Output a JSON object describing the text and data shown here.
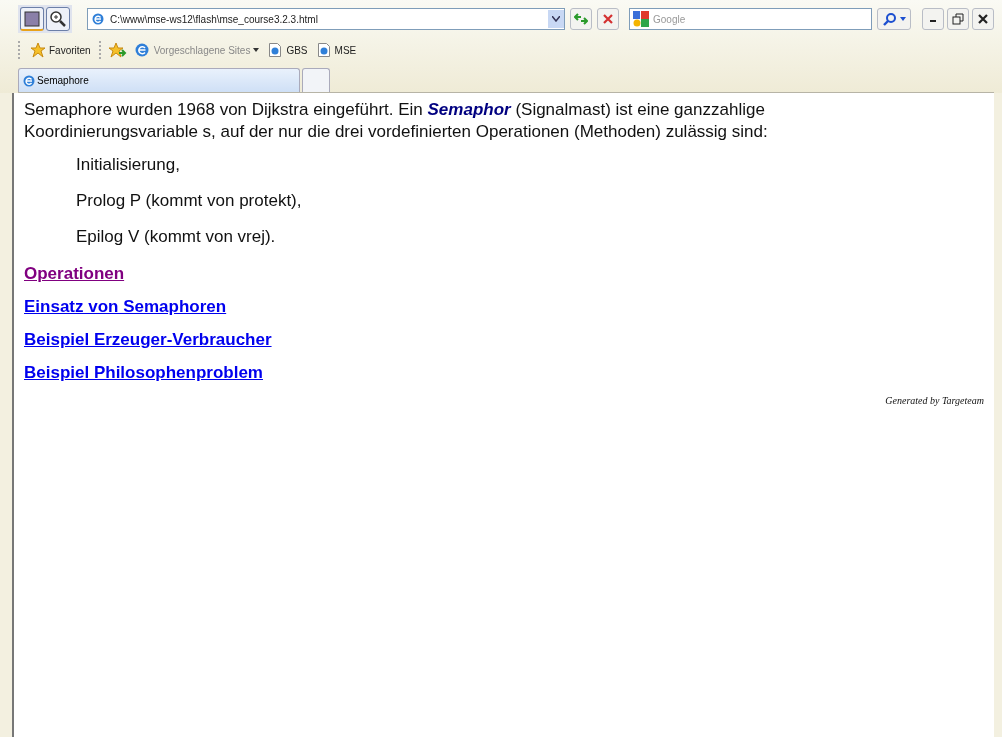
{
  "address_bar": {
    "url": "C:\\www\\mse-ws12\\flash\\mse_course3.2.3.html"
  },
  "search": {
    "placeholder": "Google"
  },
  "favorites_bar": {
    "favorites_label": "Favoriten",
    "items": [
      {
        "label": "Vorgeschlagene Sites",
        "kind": "dropdown"
      },
      {
        "label": "GBS",
        "kind": "link"
      },
      {
        "label": "MSE",
        "kind": "link"
      }
    ]
  },
  "tabs": [
    {
      "label": "Semaphore",
      "selected": true
    }
  ],
  "content": {
    "paragraph": "Semaphore wurden 1968 von Dijkstra eingeführt. Ein **Semaphor** (Signalmast) ist eine ganzzahlige Koordinierungsvariable s, auf der nur die drei vordefinierten Operationen (Methoden) zulässig sind:",
    "operations": [
      "Initialisierung,",
      "Prolog P (kommt von protekt),",
      "Epilog V (kommt von vrej)."
    ],
    "links": [
      {
        "label": "Operationen",
        "visited": true
      },
      {
        "label": "Einsatz von Semaphoren",
        "visited": false
      },
      {
        "label": "Beispiel Erzeuger-Verbraucher",
        "visited": false
      },
      {
        "label": "Beispiel Philosophenproblem",
        "visited": false
      }
    ],
    "footer": "Generated by Targeteam"
  }
}
